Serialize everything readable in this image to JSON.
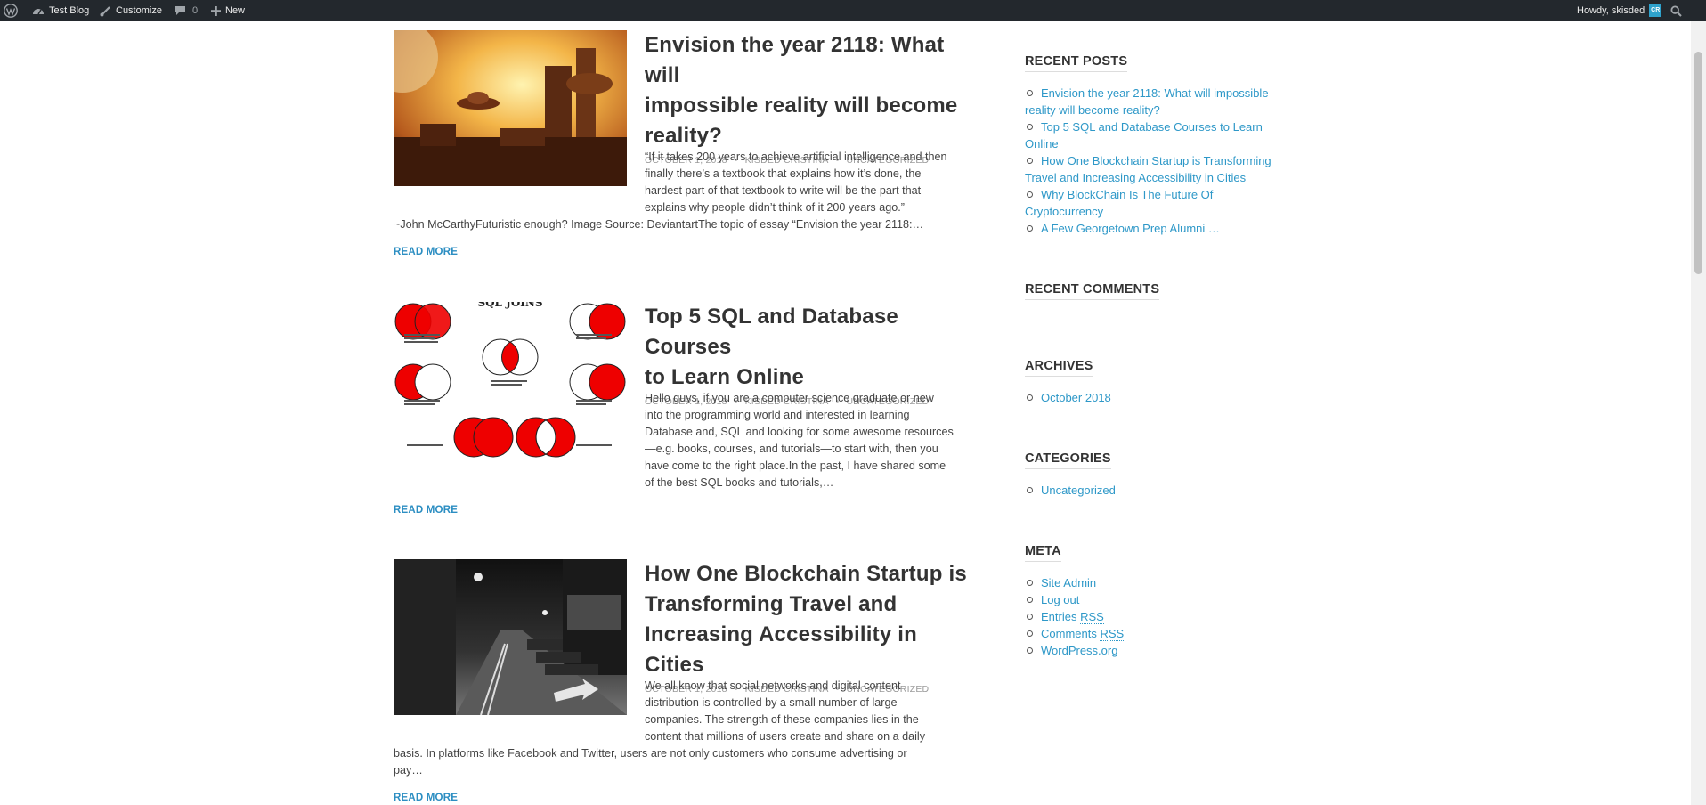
{
  "adminbar": {
    "site_name": "Test Blog",
    "customize": "Customize",
    "comments_count": "0",
    "new_label": "New",
    "howdy": "Howdy, skisded",
    "avatar_initials": "CR"
  },
  "posts": [
    {
      "title_lines": [
        "Envision the year 2118: What will",
        "impossible reality will become",
        "reality?"
      ],
      "date": "OCTOBER 1, 2018",
      "author": "KISDED CRISTINA",
      "category": "UNCATEGORIZED",
      "excerpt_wrapped": [
        "“If it takes 200 years to achieve artificial intelligence and then",
        "finally there’s a textbook that explains how it’s done, the",
        "hardest part of that textbook to write will be the part that",
        "explains why people didn’t think of it 200 years ago.”"
      ],
      "excerpt_full": [
        "~John McCarthyFuturistic enough? Image Source: DeviantartThe topic of essay “Envision the year 2118:…"
      ],
      "read_more": "READ MORE"
    },
    {
      "title_lines": [
        "Top 5 SQL and Database Courses",
        "to Learn Online"
      ],
      "date": "OCTOBER 1, 2018",
      "author": "KISDED CRISTINA",
      "category": "UNCATEGORIZED",
      "thumb_heading": "SQL JOINS",
      "excerpt_wrapped": [
        "Hello guys, if you are a computer science graduate or new",
        "into the programming world and interested in learning",
        "Database and, SQL and looking for some awesome resources",
        "—e.g. books, courses, and tutorials—to start with, then you",
        "have come to the right place.In the past, I have shared some",
        "of the best SQL books and tutorials,…"
      ],
      "excerpt_full": [],
      "read_more": "READ MORE"
    },
    {
      "title_lines": [
        "How One Blockchain Startup is",
        "Transforming Travel and",
        "Increasing Accessibility in Cities"
      ],
      "date": "OCTOBER 1, 2018",
      "author": "KISDED CRISTINA",
      "category": "UNCATEGORIZED",
      "excerpt_wrapped": [
        "We all know that social networks and digital content",
        "distribution is controlled by a small number of large",
        "companies. The strength of these companies lies in the",
        "content that millions of users create and share on a daily"
      ],
      "excerpt_full": [
        "basis. In platforms like Facebook and Twitter, users are not only customers who consume advertising or",
        "pay…"
      ],
      "read_more": "READ MORE"
    }
  ],
  "sidebar": {
    "recent_posts": {
      "title": "RECENT POSTS",
      "items": [
        [
          "Envision the year 2118: What will impossible",
          "reality will become reality?"
        ],
        [
          "Top 5 SQL and Database Courses to Learn",
          "Online"
        ],
        [
          "How One Blockchain Startup is Transforming",
          "Travel and Increasing Accessibility in Cities"
        ],
        [
          "Why BlockChain Is The Future Of",
          "Cryptocurrency"
        ],
        [
          "A Few Georgetown Prep Alumni …"
        ]
      ]
    },
    "recent_comments": {
      "title": "RECENT COMMENTS"
    },
    "archives": {
      "title": "ARCHIVES",
      "items": [
        "October 2018"
      ]
    },
    "categories": {
      "title": "CATEGORIES",
      "items": [
        "Uncategorized"
      ]
    },
    "meta": {
      "title": "META",
      "site_admin": "Site Admin",
      "log_out": "Log out",
      "entries": "Entries",
      "comments": "Comments",
      "rss": "RSS",
      "wordpress": "WordPress.org"
    }
  }
}
